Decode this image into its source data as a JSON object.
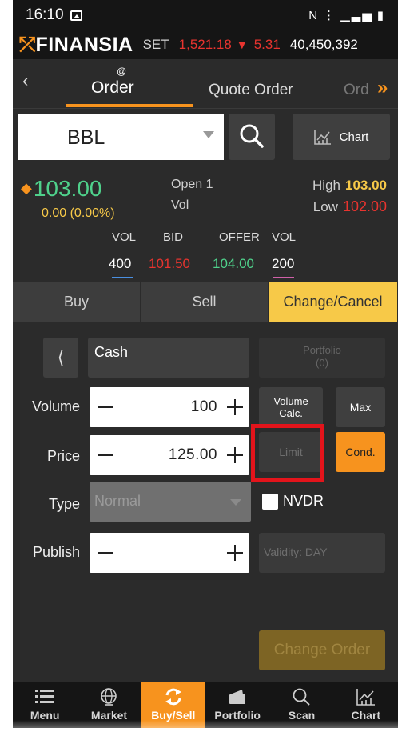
{
  "status_bar": {
    "time": "16:10",
    "icons_text": "N ⋮ ▁▃▅ ▮"
  },
  "ticker": {
    "brand": "FINANSIA",
    "index_name": "SET",
    "index_value": "1,521.18",
    "change": "5.31",
    "volume": "40,450,392"
  },
  "nav_tabs": {
    "back": "‹",
    "order": "Order",
    "order_badge": "@",
    "quote_order": "Quote Order",
    "more": "Ord",
    "next": "»"
  },
  "symbol": {
    "value": "BBL",
    "chart_label": "Chart"
  },
  "quote": {
    "last": "103.00",
    "change": "0.00 (0.00%)",
    "open_label": "Open 1",
    "vol_label": "Vol",
    "high_label": "High",
    "high_value": "103.00",
    "low_label": "Low",
    "low_value": "102.00",
    "bidoffer_headers": [
      "VOL",
      "BID",
      "OFFER",
      "VOL"
    ],
    "bid_vol": "400",
    "bid": "101.50",
    "offer": "104.00",
    "offer_vol": "200"
  },
  "side_tabs": [
    "Buy",
    "Sell",
    "Change/Cancel"
  ],
  "form": {
    "account": "Cash",
    "portfolio_label": "Portfolio",
    "portfolio_count": "(0)",
    "volume_label": "Volume",
    "volume_value": "100",
    "volume_calc_label": "Volume Calc.",
    "max_label": "Max",
    "price_label": "Price",
    "price_value": "125.00",
    "limit_placeholder": "Limit",
    "cond_label": "Cond.",
    "type_label": "Type",
    "type_value": "Normal",
    "nvdr_label": "NVDR",
    "publish_label": "Publish",
    "validity_placeholder": "Validity: DAY",
    "change_order_label": "Change Order"
  },
  "bottom_nav": [
    "Menu",
    "Market",
    "Buy/Sell",
    "Portfolio",
    "Scan",
    "Chart"
  ],
  "colors": {
    "accent": "#f7931e",
    "highlight": "#f7c948",
    "up": "#4fd18b",
    "down": "#e8342f",
    "selection_frame": "#e3141b"
  }
}
